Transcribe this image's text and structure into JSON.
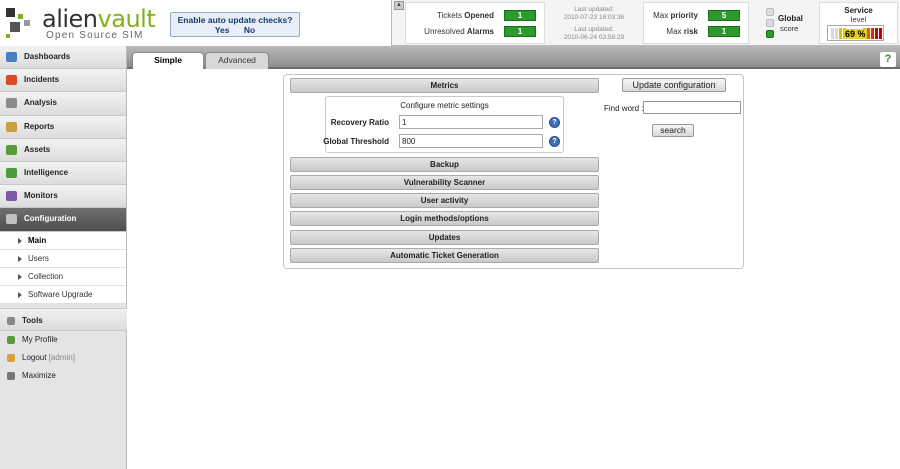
{
  "header": {
    "logo": {
      "brand_first": "alien",
      "brand_second": "vault",
      "subtitle": "Open Source SIM"
    },
    "auto_update": {
      "question": "Enable auto update checks?",
      "yes": "Yes",
      "no": "No"
    },
    "tickets": {
      "opened_label": "Tickets",
      "opened_label_bold": "Opened",
      "opened_value": "1",
      "alarms_label": "Unresolved",
      "alarms_label_bold": "Alarms",
      "alarms_value": "1"
    },
    "last_updated": [
      {
        "label": "Last updated:",
        "time": "2010-07-23 16:03:36"
      },
      {
        "label": "Last updated:",
        "time": "2010-06-24 03:58:29"
      }
    ],
    "priority": {
      "priority_label": "Max",
      "priority_label_bold": "priority",
      "priority_value": "5",
      "risk_label": "Max",
      "risk_label_bold": "risk",
      "risk_value": "1"
    },
    "global_score": {
      "title": "Global",
      "subtitle": "score"
    },
    "service": {
      "title": "Service",
      "subtitle": "level",
      "percent": 69,
      "percent_text": "69 %"
    },
    "colors": {
      "green": "#2a9a2a",
      "accent": "#7fb21a"
    }
  },
  "sidebar": {
    "items": [
      {
        "label": "Dashboards",
        "icon": "dashboard-icon",
        "color": "#4a7fc4"
      },
      {
        "label": "Incidents",
        "icon": "incidents-icon",
        "color": "#d84b2a"
      },
      {
        "label": "Analysis",
        "icon": "analysis-icon",
        "color": "#8b8b8b"
      },
      {
        "label": "Reports",
        "icon": "reports-icon",
        "color": "#c9a13a"
      },
      {
        "label": "Assets",
        "icon": "assets-icon",
        "color": "#5a9a3a"
      },
      {
        "label": "Intelligence",
        "icon": "intelligence-icon",
        "color": "#4c9a3c"
      },
      {
        "label": "Monitors",
        "icon": "monitors-icon",
        "color": "#7a5aa8"
      },
      {
        "label": "Configuration",
        "icon": "configuration-icon",
        "color": "#c0c0c0"
      }
    ],
    "subitems": [
      {
        "label": "Main"
      },
      {
        "label": "Users"
      },
      {
        "label": "Collection"
      },
      {
        "label": "Software Upgrade"
      }
    ],
    "tools": {
      "head": "Tools",
      "profile": "My Profile",
      "logout": "Logout",
      "logout_user": "[admin]",
      "maximize": "Maximize"
    }
  },
  "tabs": {
    "simple": "Simple",
    "advanced": "Advanced",
    "help": "?"
  },
  "config": {
    "metrics_title": "Metrics",
    "metric_caption": "Configure metric settings",
    "recovery_label": "Recovery Ratio",
    "recovery_value": "1",
    "threshold_label": "Global Threshold",
    "threshold_value": "800",
    "sections": [
      "Backup",
      "Vulnerability Scanner",
      "User activity",
      "Login methods/options",
      "Updates",
      "Automatic Ticket Generation"
    ],
    "update_button": "Update configuration",
    "find_label": "Find word :",
    "search_button": "search"
  }
}
